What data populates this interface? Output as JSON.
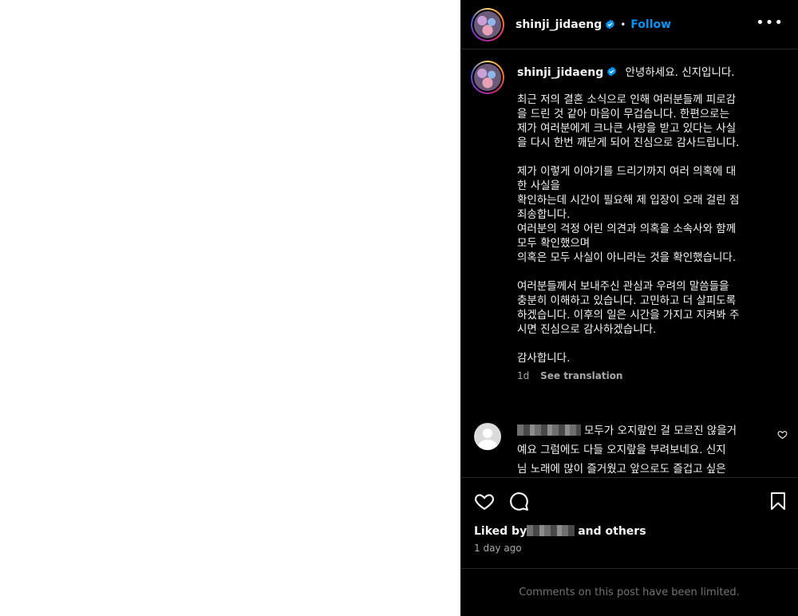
{
  "header": {
    "username": "shinji_jidaeng",
    "separator": "•",
    "follow_label": "Follow",
    "more_label": "•••"
  },
  "post": {
    "username": "shinji_jidaeng",
    "greeting": "안녕하세요. 신지입니다.",
    "paragraphs": [
      "최근 저의 결혼 소식으로 인해 여러분들께 피로감\n을 드린 것 같아 마음이 무겁습니다. 한편으로는\n제가 여러분에게 크나큰 사랑을 받고 있다는 사실\n을 다시 한번 깨닫게 되어 진심으로 감사드립니다.",
      "제가 이렇게 이야기를 드리기까지 여러 의혹에 대\n한 사실을\n확인하는데 시간이 필요해 제 입장이 오래 걸린 점\n죄송합니다.\n여러분의 걱정 어린 의견과 의혹을 소속사와 함께\n모두 확인했으며\n의혹은 모두 사실이 아니라는 것을 확인했습니다.",
      "여러분들께서 보내주신 관심과 우려의 말씀들을\n충분히 이해하고 있습니다. 고민하고 더 살피도록\n하겠습니다. 이후의 일은 시간을 가지고 지켜봐 주\n시면 진심으로 감사하겠습니다.",
      "감사합니다."
    ],
    "age": "1d",
    "translate_label": "See translation"
  },
  "comment": {
    "text": "모두가 오지랖인 걸 모르진 않을거\n예요 그럼에도 다들 오지랖을 부려보네요. 신지\n님 노래에 많이 즐거웠고 앞으로도 즐겁고 싶은\n마음일 겁니다. 서두르지만 않으셨으면 좋겠어"
  },
  "likes": {
    "prefix": "Liked by",
    "suffix": "and others"
  },
  "timestamp": "1 day ago",
  "limited_notice": "Comments on this post have been limited.",
  "colors": {
    "panel_bg": "#000000",
    "accent": "#0095f6",
    "muted": "#a8a8a8",
    "verified": "#0095f6"
  },
  "icons": [
    "verified-badge-icon",
    "more-options-icon",
    "heart-icon",
    "comment-icon",
    "bookmark-icon",
    "avatar-placeholder-icon"
  ]
}
